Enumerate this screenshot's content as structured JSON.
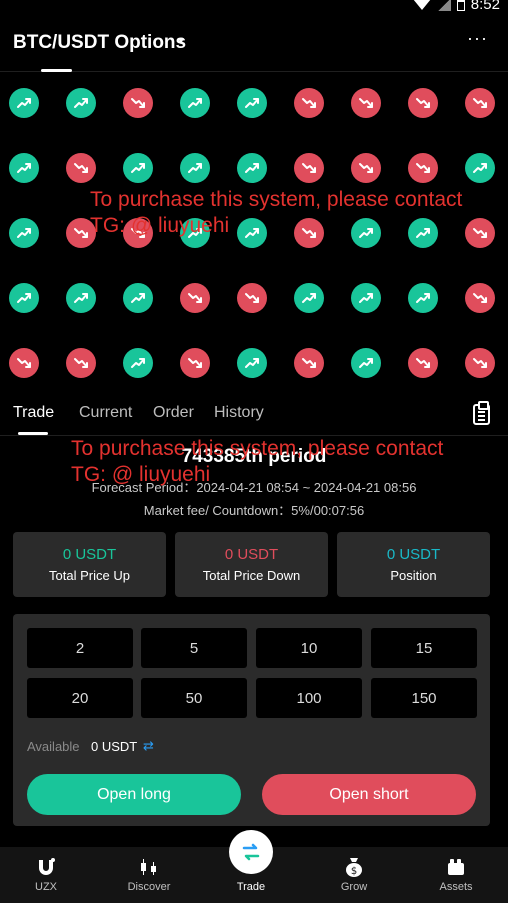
{
  "status_bar": {
    "time": "8:52"
  },
  "header": {
    "title": "BTC/USDT Options",
    "more": "···"
  },
  "results_grid": [
    [
      "up",
      "up",
      "down",
      "up",
      "up",
      "down",
      "down",
      "down",
      "down"
    ],
    [
      "up",
      "down",
      "up",
      "up",
      "up",
      "down",
      "down",
      "down",
      "up"
    ],
    [
      "up",
      "down",
      "down",
      "up",
      "up",
      "down",
      "up",
      "up",
      "down"
    ],
    [
      "up",
      "up",
      "up",
      "down",
      "down",
      "up",
      "up",
      "up",
      "down"
    ],
    [
      "down",
      "down",
      "up",
      "down",
      "up",
      "down",
      "up",
      "down",
      "down"
    ]
  ],
  "watermark": {
    "line1": "To purchase this system, please contact",
    "line2": "TG: @ liuyuehi"
  },
  "tabs": [
    {
      "label": "Trade",
      "active": true
    },
    {
      "label": "Current",
      "active": false
    },
    {
      "label": "Order",
      "active": false
    },
    {
      "label": "History",
      "active": false
    }
  ],
  "period": {
    "title": "743385th period",
    "forecast": "Forecast Period：2024-04-21 08:54 ~ 2024-04-21 08:56",
    "market": "Market fee/ Countdown：5%/00:07:56"
  },
  "cards": [
    {
      "amount": "0 USDT",
      "label": "Total Price Up",
      "color": "#19c59a"
    },
    {
      "amount": "0 USDT",
      "label": "Total Price Down",
      "color": "#e04d5c"
    },
    {
      "amount": "0 USDT",
      "label": "Position",
      "color": "#19b9c8"
    }
  ],
  "amounts": [
    "2",
    "5",
    "10",
    "15",
    "20",
    "50",
    "100",
    "150"
  ],
  "available": {
    "label": "Available",
    "value": "0 USDT"
  },
  "buttons": {
    "long": "Open long",
    "short": "Open short"
  },
  "nav": [
    {
      "label": "UZX",
      "icon": "uzx-logo-icon"
    },
    {
      "label": "Discover",
      "icon": "candlestick-icon"
    },
    {
      "label": "Trade",
      "icon": "swap-icon",
      "active": true
    },
    {
      "label": "Grow",
      "icon": "money-bag-icon"
    },
    {
      "label": "Assets",
      "icon": "wallet-icon"
    }
  ],
  "colors": {
    "up": "#19c59a",
    "down": "#e04d5c",
    "position": "#19b9c8",
    "panel": "#2b2b2b"
  }
}
